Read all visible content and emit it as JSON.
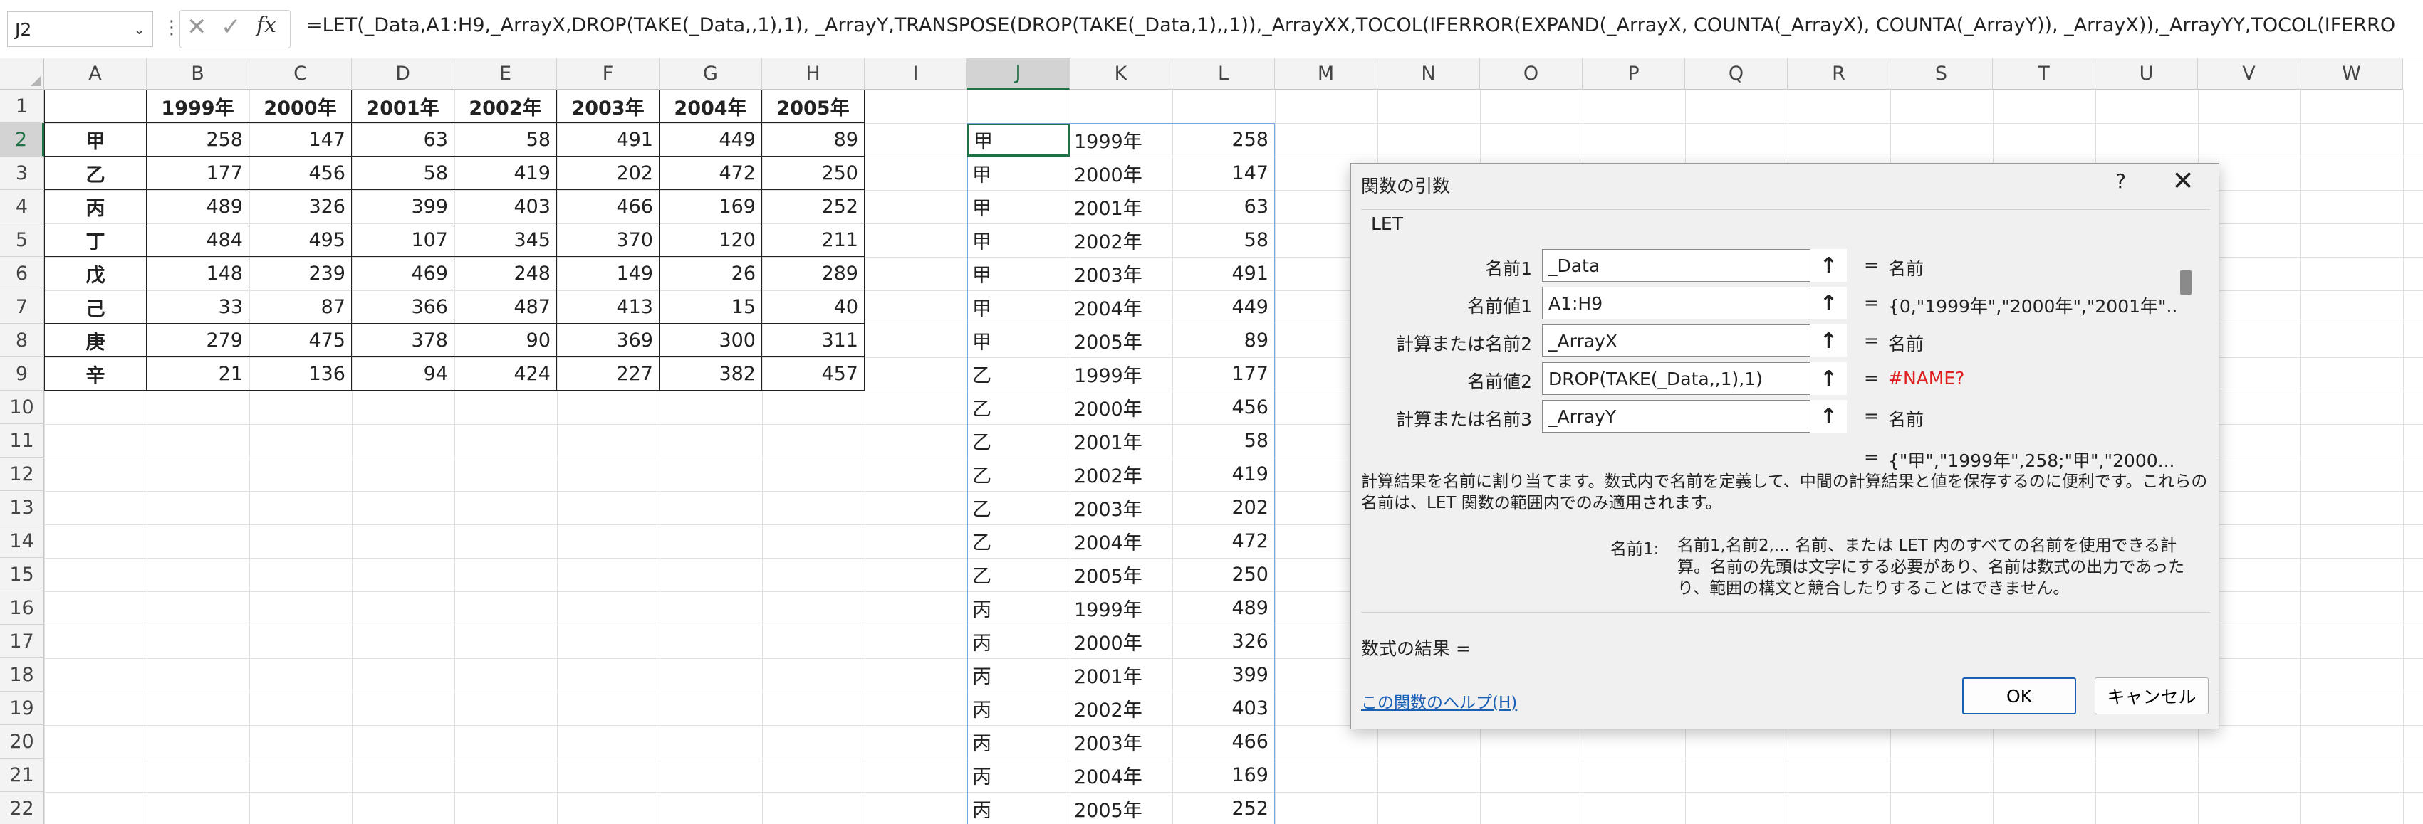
{
  "formula_bar": {
    "name_box": "J2",
    "formula": "=LET(_Data,A1:H9,_ArrayX,DROP(TAKE(_Data,,1),1), _ArrayY,TRANSPOSE(DROP(TAKE(_Data,1),,1)),_ArrayXX,TOCOL(IFERROR(EXPAND(_ArrayX, COUNTA(_ArrayX), COUNTA(_ArrayY)), _ArrayX)),_ArrayYY,TOCOL(IFERRO"
  },
  "columns": [
    "A",
    "B",
    "C",
    "D",
    "E",
    "F",
    "G",
    "H",
    "I",
    "J",
    "K",
    "L",
    "M",
    "N",
    "O",
    "P",
    "Q",
    "R",
    "S",
    "T",
    "U",
    "V",
    "W"
  ],
  "rows": [
    "1",
    "2",
    "3",
    "4",
    "5",
    "6",
    "7",
    "8",
    "9",
    "10",
    "11",
    "12",
    "13",
    "14",
    "15",
    "16",
    "17",
    "18",
    "19",
    "20",
    "21",
    "22"
  ],
  "table": {
    "headers": [
      "1999年",
      "2000年",
      "2001年",
      "2002年",
      "2003年",
      "2004年",
      "2005年"
    ],
    "rows": [
      {
        "name": "甲",
        "values": [
          258,
          147,
          63,
          58,
          491,
          449,
          89
        ]
      },
      {
        "name": "乙",
        "values": [
          177,
          456,
          58,
          419,
          202,
          472,
          250
        ]
      },
      {
        "name": "丙",
        "values": [
          489,
          326,
          399,
          403,
          466,
          169,
          252
        ]
      },
      {
        "name": "丁",
        "values": [
          484,
          495,
          107,
          345,
          370,
          120,
          211
        ]
      },
      {
        "name": "戊",
        "values": [
          148,
          239,
          469,
          248,
          149,
          26,
          289
        ]
      },
      {
        "name": "己",
        "values": [
          33,
          87,
          366,
          487,
          413,
          15,
          40
        ]
      },
      {
        "name": "庚",
        "values": [
          279,
          475,
          378,
          90,
          369,
          300,
          311
        ]
      },
      {
        "name": "辛",
        "values": [
          21,
          136,
          94,
          424,
          227,
          382,
          457
        ]
      }
    ]
  },
  "spill": [
    [
      "甲",
      "1999年",
      258
    ],
    [
      "甲",
      "2000年",
      147
    ],
    [
      "甲",
      "2001年",
      63
    ],
    [
      "甲",
      "2002年",
      58
    ],
    [
      "甲",
      "2003年",
      491
    ],
    [
      "甲",
      "2004年",
      449
    ],
    [
      "甲",
      "2005年",
      89
    ],
    [
      "乙",
      "1999年",
      177
    ],
    [
      "乙",
      "2000年",
      456
    ],
    [
      "乙",
      "2001年",
      58
    ],
    [
      "乙",
      "2002年",
      419
    ],
    [
      "乙",
      "2003年",
      202
    ],
    [
      "乙",
      "2004年",
      472
    ],
    [
      "乙",
      "2005年",
      250
    ],
    [
      "丙",
      "1999年",
      489
    ],
    [
      "丙",
      "2000年",
      326
    ],
    [
      "丙",
      "2001年",
      399
    ],
    [
      "丙",
      "2002年",
      403
    ],
    [
      "丙",
      "2003年",
      466
    ],
    [
      "丙",
      "2004年",
      169
    ],
    [
      "丙",
      "2005年",
      252
    ]
  ],
  "dialog": {
    "title": "関数の引数",
    "help_glyph": "?",
    "close_glyph": "✕",
    "function_name": "LET",
    "args": [
      {
        "label": "名前1",
        "input": "_Data",
        "value": "名前",
        "error": false
      },
      {
        "label": "名前値1",
        "input": "A1:H9",
        "value": "{0,\"1999年\",\"2000年\",\"2001年\"...",
        "error": false
      },
      {
        "label": "計算または名前2",
        "input": "_ArrayX",
        "value": "名前",
        "error": false
      },
      {
        "label": "名前値2",
        "input": "DROP(TAKE(_Data,,1),1)",
        "value": "#NAME?",
        "error": true
      },
      {
        "label": "計算または名前3",
        "input": "_ArrayY",
        "value": "名前",
        "error": false
      }
    ],
    "ref_glyph": "↑",
    "equals": "=",
    "result_preview": "{\"甲\",\"1999年\",258;\"甲\",\"2000...",
    "description": "計算結果を名前に割り当てます。数式内で名前を定義して、中間の計算結果と値を保存するのに便利です。これらの名前は、LET 関数の範囲内でのみ適用されます。",
    "arg_name": "名前1:",
    "arg_description": "名前1,名前2,... 名前、または LET 内のすべての名前を使用できる計算。名前の先頭は文字にする必要があり、名前は数式の出力であったり、範囲の構文と競合したりすることはできません。",
    "formula_result": "数式の結果 =",
    "help_link": "この関数のヘルプ(H)",
    "ok": "OK",
    "cancel": "キャンセル"
  }
}
